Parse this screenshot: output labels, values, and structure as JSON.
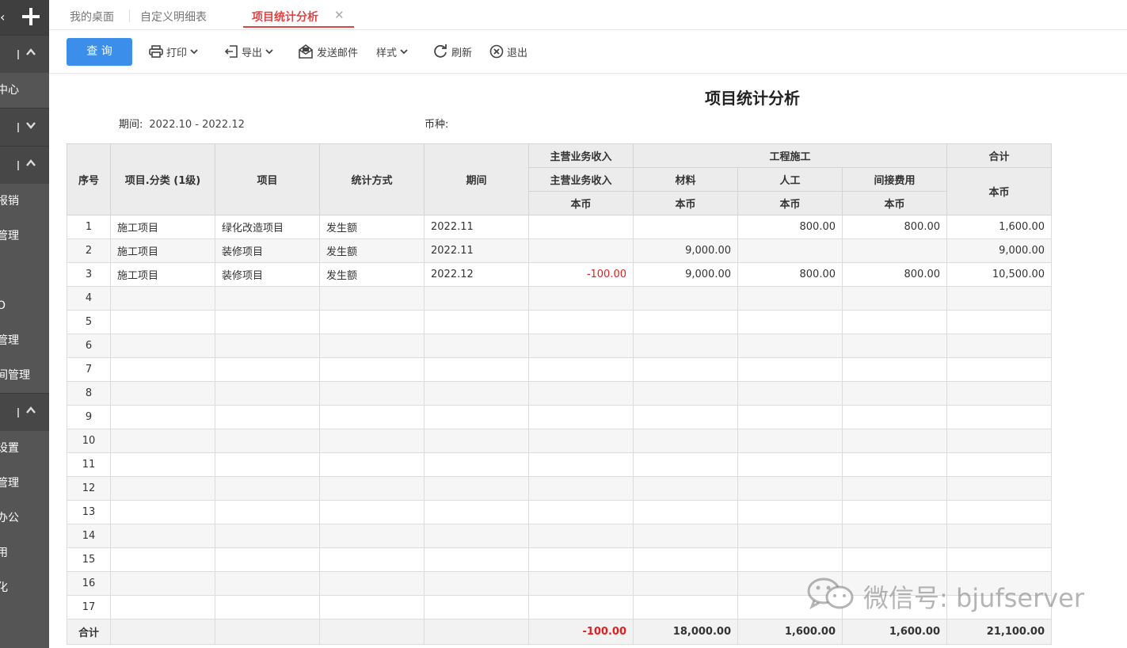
{
  "sidebar": {
    "items": [
      "中心",
      "报销",
      "管理",
      "O",
      "管理",
      "间管理",
      "设置",
      "管理",
      "办公",
      "用",
      "化"
    ]
  },
  "tabs": [
    {
      "label": "我的桌面"
    },
    {
      "label": "自定义明细表"
    },
    {
      "label": "项目统计分析"
    }
  ],
  "toolbar": {
    "query": "查 询",
    "print": "打印",
    "export": "导出",
    "send_mail": "发送邮件",
    "style": "样式",
    "refresh": "刷新",
    "exit": "退出"
  },
  "report": {
    "title": "项目统计分析",
    "period_label": "期间:",
    "period_value": "2022.10 - 2022.12",
    "currency_label": "币种:",
    "currency_value": ""
  },
  "table": {
    "headers": {
      "seq": "序号",
      "category": "项目.分类 (1级)",
      "project": "项目",
      "method": "统计方式",
      "period": "期间",
      "main_income_group": "主营业务收入",
      "main_income": "主营业务收入",
      "construction": "工程施工",
      "material": "材料",
      "labor": "人工",
      "indirect": "间接费用",
      "total": "合计",
      "currency": "本币"
    },
    "rows": [
      {
        "seq": "1",
        "category": "施工项目",
        "project": "绿化改造项目",
        "method": "发生额",
        "period": "2022.11",
        "income": "",
        "material": "",
        "labor": "800.00",
        "indirect": "800.00",
        "total": "1,600.00"
      },
      {
        "seq": "2",
        "category": "施工项目",
        "project": "装修项目",
        "method": "发生额",
        "period": "2022.11",
        "income": "",
        "material": "9,000.00",
        "labor": "",
        "indirect": "",
        "total": "9,000.00"
      },
      {
        "seq": "3",
        "category": "施工项目",
        "project": "装修项目",
        "method": "发生额",
        "period": "2022.12",
        "income": "-100.00",
        "material": "9,000.00",
        "labor": "800.00",
        "indirect": "800.00",
        "total": "10,500.00"
      },
      {
        "seq": "4"
      },
      {
        "seq": "5"
      },
      {
        "seq": "6"
      },
      {
        "seq": "7"
      },
      {
        "seq": "8"
      },
      {
        "seq": "9"
      },
      {
        "seq": "10"
      },
      {
        "seq": "11"
      },
      {
        "seq": "12"
      },
      {
        "seq": "13"
      },
      {
        "seq": "14"
      },
      {
        "seq": "15"
      },
      {
        "seq": "16"
      },
      {
        "seq": "17"
      }
    ],
    "totals": {
      "label": "合计",
      "income": "-100.00",
      "material": "18,000.00",
      "labor": "1,600.00",
      "indirect": "1,600.00",
      "total": "21,100.00"
    }
  },
  "watermark": "微信号: bjufserver",
  "colors": {
    "accent": "#3b8eea",
    "active_tab": "#e04343",
    "negative": "#e02020",
    "sidebar": "#555555"
  }
}
